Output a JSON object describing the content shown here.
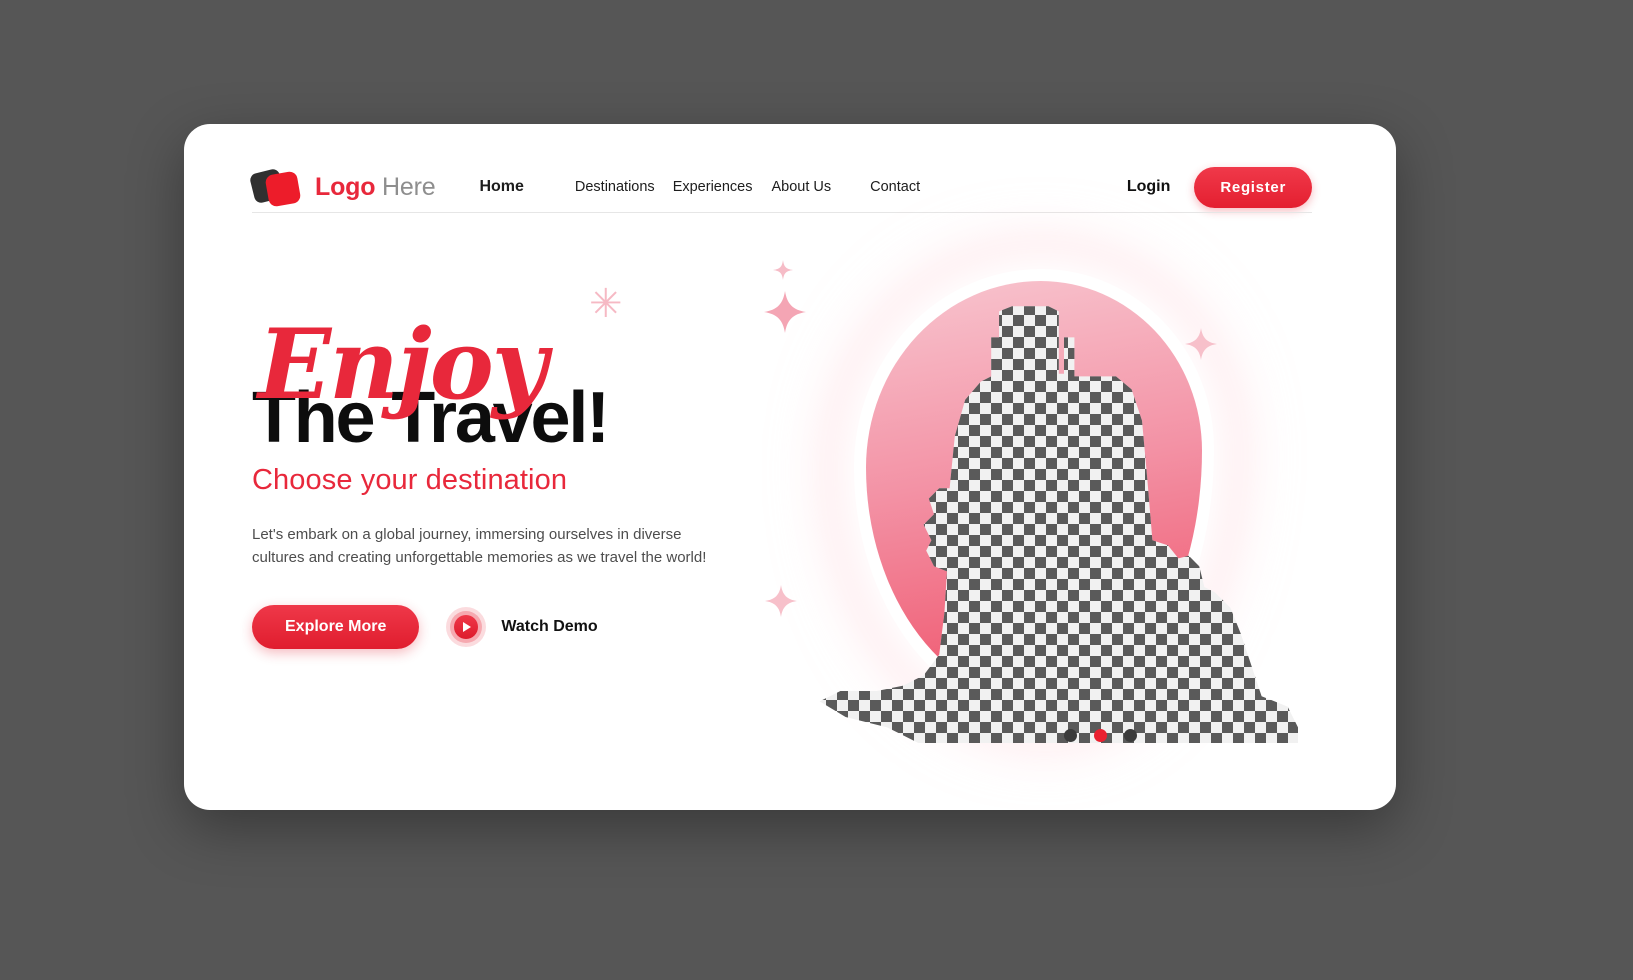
{
  "page": {
    "background_color": "#565656",
    "card_color": "#ffffff",
    "accent_color": "#e8283b",
    "accent_dark": "#e01d2e"
  },
  "nav": {
    "logo": {
      "icon": "logo-squares-icon",
      "text_bold": "Logo",
      "text_light": " Here"
    },
    "links": [
      {
        "label": "Home",
        "active": true
      },
      {
        "label": "Destinations",
        "active": false
      },
      {
        "label": "Experiences",
        "active": false
      },
      {
        "label": "About Us",
        "active": false
      },
      {
        "label": "Contact",
        "active": false
      }
    ],
    "login_label": "Login",
    "register_label": "Register"
  },
  "hero": {
    "headline_script": "Enjoy",
    "headline_bold": "The Travel!",
    "subtitle": "Choose your destination",
    "body": "Let's embark on a global journey, immersing ourselves in diverse cultures and creating unforgettable memories as we travel the world!",
    "primary_cta": "Explore More",
    "secondary_cta": "Watch Demo",
    "play_icon": "play-icon"
  },
  "illustration": {
    "placeholder_state": "transparent-checkerboard-image-placeholder",
    "blob_color_start": "#f8c5cf",
    "blob_color_end": "#ef4b63",
    "sparkle_color": "#f8bfc8",
    "sparkles": [
      "sparkle-icon",
      "sparkle-icon",
      "sparkle-icon",
      "sparkle-icon"
    ],
    "asterisk": "✳"
  },
  "carousel": {
    "dots": [
      {
        "active": false
      },
      {
        "active": true
      },
      {
        "active": false
      }
    ]
  }
}
